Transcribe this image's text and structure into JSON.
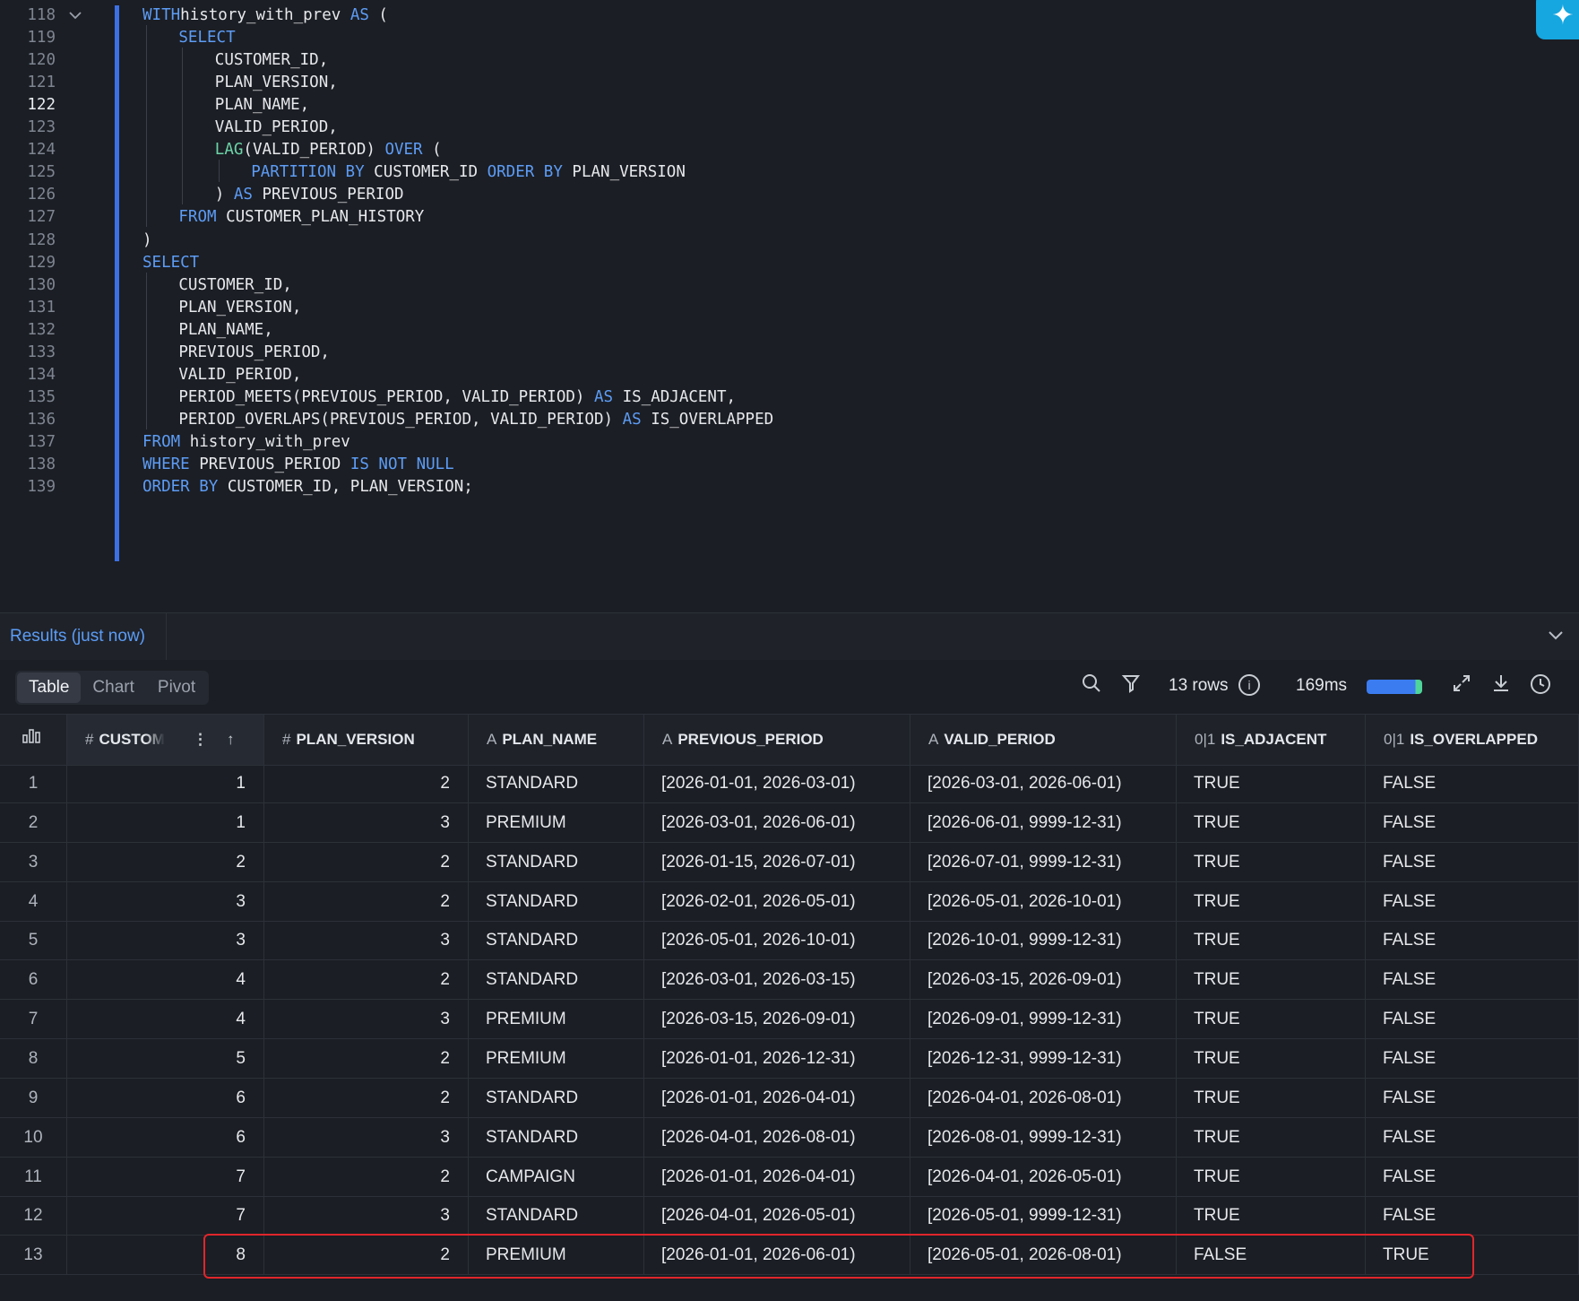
{
  "editor": {
    "active_line": 122,
    "lines": [
      {
        "n": 118,
        "fold": true,
        "indent": 0,
        "tokens": [
          [
            "kw",
            "WITH"
          ],
          [
            "",
            "history_with_prev "
          ],
          [
            "kw",
            "AS"
          ],
          [
            "",
            " ("
          ]
        ]
      },
      {
        "n": 119,
        "indent": 1,
        "tokens": [
          [
            "kw",
            "SELECT"
          ]
        ]
      },
      {
        "n": 120,
        "indent": 2,
        "tokens": [
          [
            "",
            "CUSTOMER_ID,"
          ]
        ]
      },
      {
        "n": 121,
        "indent": 2,
        "tokens": [
          [
            "",
            "PLAN_VERSION,"
          ]
        ]
      },
      {
        "n": 122,
        "indent": 2,
        "tokens": [
          [
            "",
            "PLAN_NAME,"
          ]
        ]
      },
      {
        "n": 123,
        "indent": 2,
        "tokens": [
          [
            "",
            "VALID_PERIOD,"
          ]
        ]
      },
      {
        "n": 124,
        "indent": 2,
        "tokens": [
          [
            "fn",
            "LAG"
          ],
          [
            "",
            "(VALID_PERIOD) "
          ],
          [
            "kw",
            "OVER"
          ],
          [
            "",
            " ("
          ]
        ]
      },
      {
        "n": 125,
        "indent": 3,
        "tokens": [
          [
            "kw",
            "PARTITION BY"
          ],
          [
            "",
            " CUSTOMER_ID "
          ],
          [
            "kw",
            "ORDER BY"
          ],
          [
            "",
            " PLAN_VERSION"
          ]
        ]
      },
      {
        "n": 126,
        "indent": 2,
        "tokens": [
          [
            "",
            ") "
          ],
          [
            "kw",
            "AS"
          ],
          [
            "",
            " PREVIOUS_PERIOD"
          ]
        ]
      },
      {
        "n": 127,
        "indent": 1,
        "tokens": [
          [
            "kw",
            "FROM"
          ],
          [
            "",
            " CUSTOMER_PLAN_HISTORY"
          ]
        ]
      },
      {
        "n": 128,
        "indent": 0,
        "tokens": [
          [
            "",
            ")"
          ]
        ]
      },
      {
        "n": 129,
        "indent": 0,
        "tokens": [
          [
            "kw",
            "SELECT"
          ]
        ]
      },
      {
        "n": 130,
        "indent": 1,
        "tokens": [
          [
            "",
            "CUSTOMER_ID,"
          ]
        ]
      },
      {
        "n": 131,
        "indent": 1,
        "tokens": [
          [
            "",
            "PLAN_VERSION,"
          ]
        ]
      },
      {
        "n": 132,
        "indent": 1,
        "tokens": [
          [
            "",
            "PLAN_NAME,"
          ]
        ]
      },
      {
        "n": 133,
        "indent": 1,
        "tokens": [
          [
            "",
            "PREVIOUS_PERIOD,"
          ]
        ]
      },
      {
        "n": 134,
        "indent": 1,
        "tokens": [
          [
            "",
            "VALID_PERIOD,"
          ]
        ]
      },
      {
        "n": 135,
        "indent": 1,
        "tokens": [
          [
            "",
            "PERIOD_MEETS(PREVIOUS_PERIOD, VALID_PERIOD) "
          ],
          [
            "kw",
            "AS"
          ],
          [
            "",
            " IS_ADJACENT,"
          ]
        ]
      },
      {
        "n": 136,
        "indent": 1,
        "tokens": [
          [
            "",
            "PERIOD_OVERLAPS(PREVIOUS_PERIOD, VALID_PERIOD) "
          ],
          [
            "kw",
            "AS"
          ],
          [
            "",
            " IS_OVERLAPPED"
          ]
        ]
      },
      {
        "n": 137,
        "indent": 0,
        "tokens": [
          [
            "kw",
            "FROM"
          ],
          [
            "",
            " history_with_prev"
          ]
        ]
      },
      {
        "n": 138,
        "indent": 0,
        "tokens": [
          [
            "kw",
            "WHERE"
          ],
          [
            "",
            " PREVIOUS_PERIOD "
          ],
          [
            "kw",
            "IS NOT NULL"
          ]
        ]
      },
      {
        "n": 139,
        "indent": 0,
        "tokens": [
          [
            "kw",
            "ORDER BY"
          ],
          [
            "",
            " CUSTOMER_ID, PLAN_VERSION;"
          ]
        ]
      }
    ]
  },
  "results": {
    "tab_label": "Results (just now)",
    "view_tabs": [
      {
        "label": "Table",
        "active": true
      },
      {
        "label": "Chart",
        "active": false
      },
      {
        "label": "Pivot",
        "active": false
      }
    ],
    "rows_label": "13 rows",
    "duration": "169ms",
    "columns": [
      {
        "label": "",
        "icon": "column-stats-icon",
        "type": "idx"
      },
      {
        "label": "CUSTOMER_ID",
        "display": "CUSTOM",
        "icon": "#",
        "type": "num",
        "sorted": true
      },
      {
        "label": "PLAN_VERSION",
        "icon": "#",
        "type": "num"
      },
      {
        "label": "PLAN_NAME",
        "icon": "A",
        "type": "txt"
      },
      {
        "label": "PREVIOUS_PERIOD",
        "icon": "A",
        "type": "txt"
      },
      {
        "label": "VALID_PERIOD",
        "icon": "A",
        "type": "txt"
      },
      {
        "label": "IS_ADJACENT",
        "icon": "0|1",
        "type": "txt"
      },
      {
        "label": "IS_OVERLAPPED",
        "icon": "0|1",
        "type": "txt"
      }
    ],
    "rows": [
      [
        "1",
        "1",
        "2",
        "STANDARD",
        "[2026-01-01, 2026-03-01)",
        "[2026-03-01, 2026-06-01)",
        "TRUE",
        "FALSE"
      ],
      [
        "2",
        "1",
        "3",
        "PREMIUM",
        "[2026-03-01, 2026-06-01)",
        "[2026-06-01, 9999-12-31)",
        "TRUE",
        "FALSE"
      ],
      [
        "3",
        "2",
        "2",
        "STANDARD",
        "[2026-01-15, 2026-07-01)",
        "[2026-07-01, 9999-12-31)",
        "TRUE",
        "FALSE"
      ],
      [
        "4",
        "3",
        "2",
        "STANDARD",
        "[2026-02-01, 2026-05-01)",
        "[2026-05-01, 2026-10-01)",
        "TRUE",
        "FALSE"
      ],
      [
        "5",
        "3",
        "3",
        "STANDARD",
        "[2026-05-01, 2026-10-01)",
        "[2026-10-01, 9999-12-31)",
        "TRUE",
        "FALSE"
      ],
      [
        "6",
        "4",
        "2",
        "STANDARD",
        "[2026-03-01, 2026-03-15)",
        "[2026-03-15, 2026-09-01)",
        "TRUE",
        "FALSE"
      ],
      [
        "7",
        "4",
        "3",
        "PREMIUM",
        "[2026-03-15, 2026-09-01)",
        "[2026-09-01, 9999-12-31)",
        "TRUE",
        "FALSE"
      ],
      [
        "8",
        "5",
        "2",
        "PREMIUM",
        "[2026-01-01, 2026-12-31)",
        "[2026-12-31, 9999-12-31)",
        "TRUE",
        "FALSE"
      ],
      [
        "9",
        "6",
        "2",
        "STANDARD",
        "[2026-01-01, 2026-04-01)",
        "[2026-04-01, 2026-08-01)",
        "TRUE",
        "FALSE"
      ],
      [
        "10",
        "6",
        "3",
        "STANDARD",
        "[2026-04-01, 2026-08-01)",
        "[2026-08-01, 9999-12-31)",
        "TRUE",
        "FALSE"
      ],
      [
        "11",
        "7",
        "2",
        "CAMPAIGN",
        "[2026-01-01, 2026-04-01)",
        "[2026-04-01, 2026-05-01)",
        "TRUE",
        "FALSE"
      ],
      [
        "12",
        "7",
        "3",
        "STANDARD",
        "[2026-04-01, 2026-05-01)",
        "[2026-05-01, 9999-12-31)",
        "TRUE",
        "FALSE"
      ],
      [
        "13",
        "8",
        "2",
        "PREMIUM",
        "[2026-01-01, 2026-06-01)",
        "[2026-05-01, 2026-08-01)",
        "FALSE",
        "TRUE"
      ]
    ],
    "highlighted_row": 13,
    "highlight_color": "#e0262b"
  },
  "colors": {
    "accent": "#3c71e6",
    "keyword": "#5d9cf5",
    "function": "#6cd4a8",
    "ai_button": "#16a6e0"
  }
}
